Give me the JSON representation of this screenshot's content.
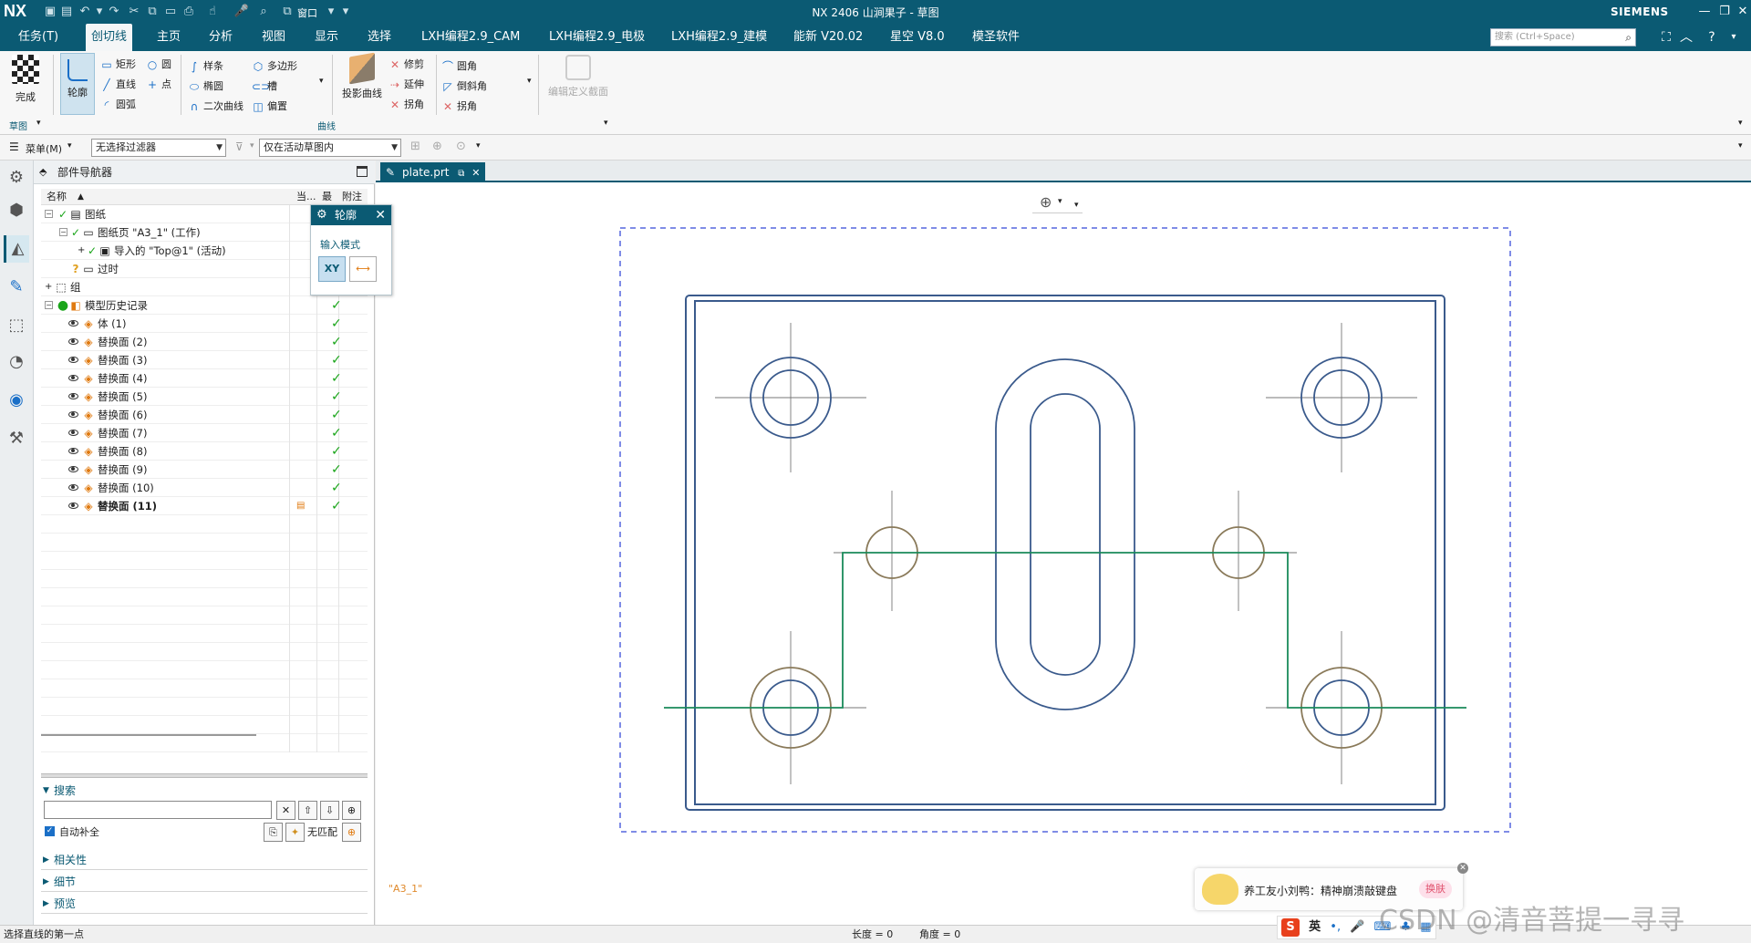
{
  "titlebar": {
    "logo": "NX",
    "title": "NX 2406 山涧果子 - 草图",
    "window_menu": "窗口",
    "brand": "SIEMENS",
    "quick_access_icons": [
      "save-icon",
      "save-all-icon",
      "undo-icon",
      "redo-icon",
      "cut-icon",
      "copy-icon",
      "paste-icon",
      "print-icon",
      "touch-mode-icon",
      "voice-icon",
      "command-finder-icon",
      "window-icon"
    ]
  },
  "menubar": {
    "tabs": [
      "任务(T)",
      "创切线",
      "主页",
      "分析",
      "视图",
      "显示",
      "选择",
      "LXH编程2.9_CAM",
      "LXH编程2.9_电极",
      "LXH编程2.9_建模",
      "能新 V20.02",
      "星空 V8.0",
      "模圣软件"
    ],
    "active_tab": "创切线",
    "search_placeholder": "搜索 (Ctrl+Space)"
  },
  "ribbon": {
    "finish_label": "完成",
    "outline_label": "轮廓",
    "col1": [
      "矩形",
      "直线",
      "圆弧"
    ],
    "col1b": [
      "圆",
      "点"
    ],
    "col2": [
      "样条",
      "椭圆",
      "二次曲线"
    ],
    "col3": [
      "多边形",
      "槽",
      "偏置"
    ],
    "project_label": "投影曲线",
    "col4": [
      "修剪",
      "延伸",
      "拐角"
    ],
    "col5": [
      "圆角",
      "倒斜角",
      "拐角"
    ],
    "edit_def_label": "编辑定义截面",
    "group_sketch": "草图",
    "group_curve": "曲线"
  },
  "filterbar": {
    "menu_label": "菜单(M)",
    "filter_value": "无选择过滤器",
    "scope_value": "仅在活动草图内"
  },
  "navigator": {
    "title": "部件导航器",
    "columns": [
      "名称",
      "当...",
      "最",
      "附注"
    ],
    "rows": [
      {
        "label": "图纸",
        "indent": 0,
        "check": false
      },
      {
        "label": "图纸页 \"A3_1\" (工作)",
        "indent": 1,
        "check": false
      },
      {
        "label": "导入的 \"Top@1\" (活动)",
        "indent": 2,
        "check": false
      },
      {
        "label": "过时",
        "indent": 1,
        "check": false
      },
      {
        "label": "组",
        "indent": 0,
        "check": false
      },
      {
        "label": "模型历史记录",
        "indent": 0,
        "check": true
      },
      {
        "label": "体 (1)",
        "indent": 1,
        "check": true
      },
      {
        "label": "替换面 (2)",
        "indent": 1,
        "check": true
      },
      {
        "label": "替换面 (3)",
        "indent": 1,
        "check": true
      },
      {
        "label": "替换面 (4)",
        "indent": 1,
        "check": true
      },
      {
        "label": "替换面 (5)",
        "indent": 1,
        "check": true
      },
      {
        "label": "替换面 (6)",
        "indent": 1,
        "check": true
      },
      {
        "label": "替换面 (7)",
        "indent": 1,
        "check": true
      },
      {
        "label": "替换面 (8)",
        "indent": 1,
        "check": true
      },
      {
        "label": "替换面 (9)",
        "indent": 1,
        "check": true
      },
      {
        "label": "替换面 (10)",
        "indent": 1,
        "check": true
      },
      {
        "label": "替换面 (11)",
        "indent": 1,
        "check": true
      }
    ],
    "search_section": "搜索",
    "auto_complete": "自动补全",
    "no_match": "无匹配",
    "sections": [
      "相关性",
      "细节",
      "预览"
    ]
  },
  "graphics": {
    "doc_tab": "plate.prt",
    "sheet_name": "\"A3_1\"",
    "colors": {
      "part": "#3a5a8c",
      "sketch": "#1a8a5a",
      "border": "#5566dd",
      "center": "#777777"
    }
  },
  "dialog": {
    "title": "轮廓",
    "input_mode": "输入模式",
    "xy": "XY"
  },
  "status": {
    "prompt": "选择直线的第一点",
    "length": "长度 = 0",
    "angle": "角度 = 0"
  },
  "toast": {
    "message": "养工友小刘鸭：精神崩溃敲键盘",
    "skin": "换肤"
  },
  "ime": {
    "label": "英"
  },
  "watermark": "CSDN @清音菩提一寻寻"
}
